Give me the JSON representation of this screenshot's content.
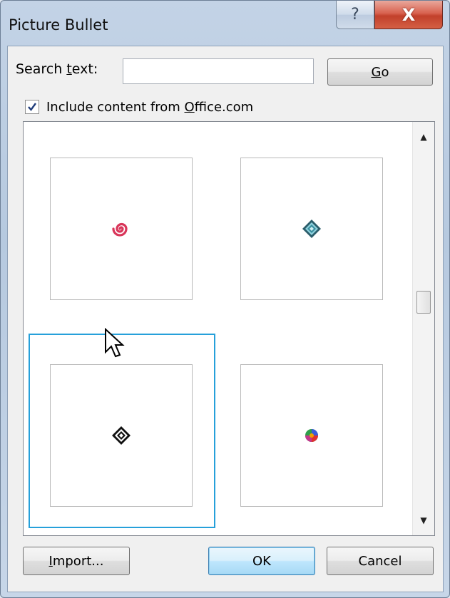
{
  "window": {
    "title": "Picture Bullet",
    "help_glyph": "?",
    "close_glyph": "X"
  },
  "search": {
    "label_prefix": "Search ",
    "label_mnemonic": "t",
    "label_suffix": "ext:",
    "value": "",
    "placeholder": ""
  },
  "go_button": {
    "mnemonic": "G",
    "rest": "o"
  },
  "include_checkbox": {
    "checked": true,
    "label_prefix": "Include content from ",
    "label_mnemonic": "O",
    "label_suffix": "ffice.com"
  },
  "gallery": {
    "items": [
      {
        "icon": "red-spiral-bullet-icon",
        "color": "#d9365a"
      },
      {
        "icon": "teal-diamond-bullet-icon",
        "color": "#3a8fa0"
      },
      {
        "icon": "black-diamond-bullet-icon",
        "color": "#111111",
        "selected": true
      },
      {
        "icon": "multicolor-ball-bullet-icon",
        "color": "#c4368d"
      }
    ],
    "selection_color": "#26a0da"
  },
  "buttons": {
    "import": {
      "mnemonic": "I",
      "rest": "mport..."
    },
    "ok": "OK",
    "cancel": "Cancel"
  },
  "colors": {
    "accent": "#26a0da",
    "close_red": "#c2402b"
  }
}
